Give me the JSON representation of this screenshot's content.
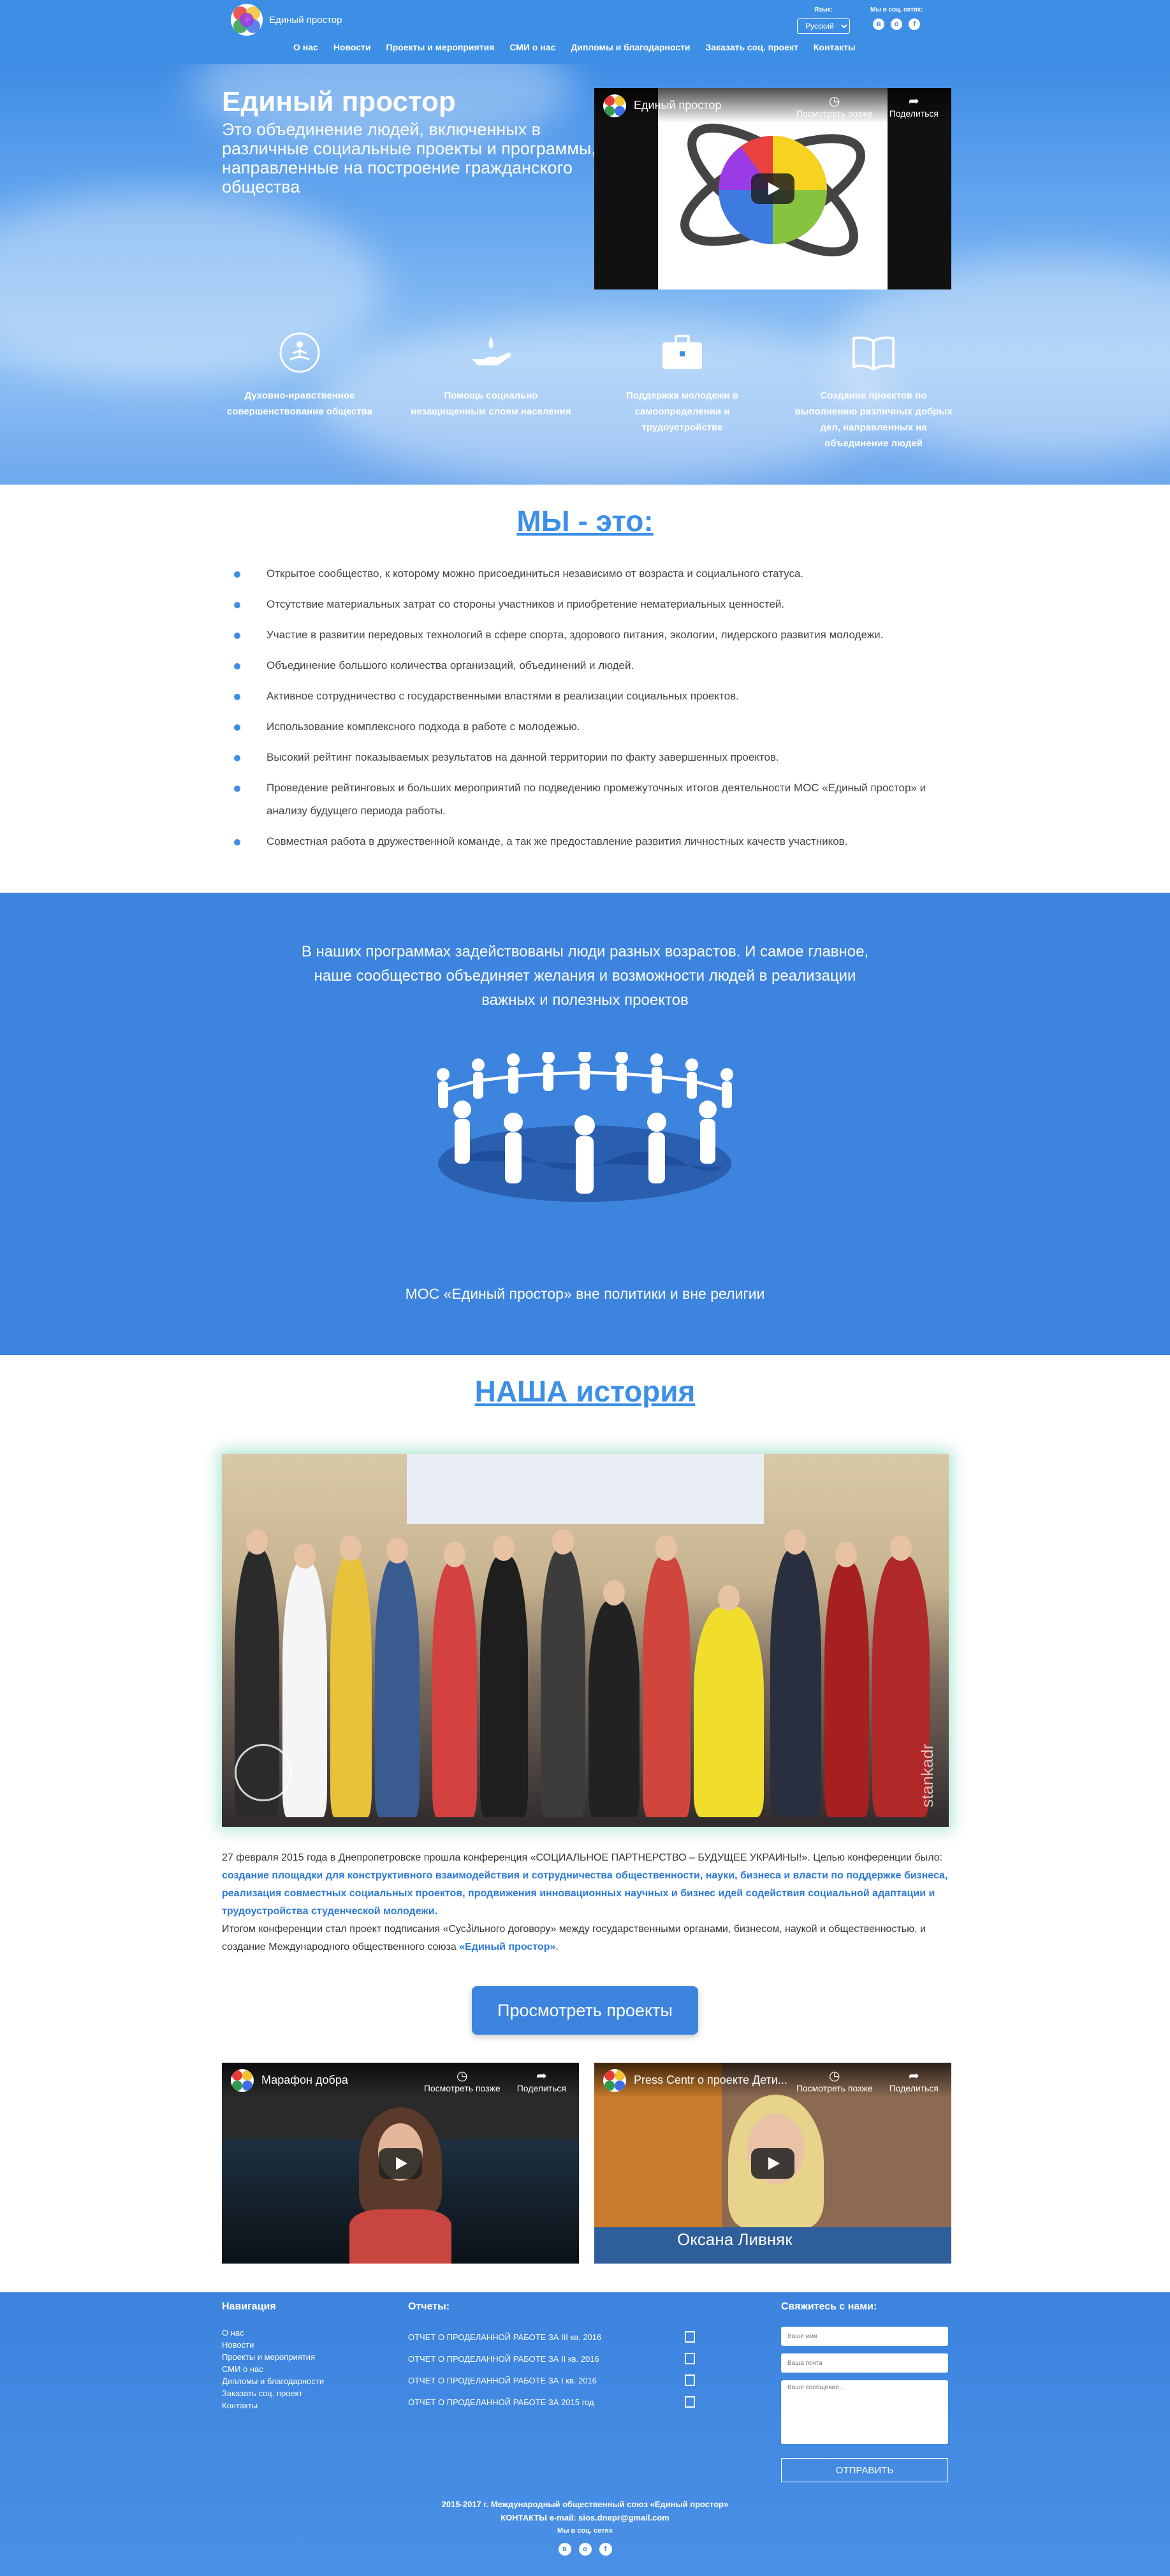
{
  "header": {
    "logo_text": "Единый простор",
    "lang_label": "Язык:",
    "lang_value": "Русский",
    "social_label": "Мы в соц. сетях:",
    "social_icons": [
      "vk-icon",
      "odnoklassniki-icon",
      "facebook-icon"
    ],
    "nav": [
      "О нас",
      "Новости",
      "Проекты и мероприятия",
      "СМИ о нас",
      "Дипломы и благодарности",
      "Заказать соц. проект",
      "Контакты"
    ]
  },
  "hero": {
    "title": "Единый простор",
    "subtitle": "Это объединение людей, включенных в различные социальные проекты и программы, направленные на построение гражданского общества",
    "video": {
      "title": "Единый простор",
      "watch_later": "Посмотреть позже",
      "share": "Поделиться"
    },
    "features": [
      {
        "icon": "meditation-icon",
        "text": "Духовно-нравственное совершенствование общества"
      },
      {
        "icon": "hand-drop-icon",
        "text": "Помощь социально незащищенным слоям населения"
      },
      {
        "icon": "briefcase-icon",
        "text": "Поддержка молодежи в самоопределении и трудоустройстве"
      },
      {
        "icon": "book-icon",
        "text": "Создание проектов по выполнению различных добрых дел, направленных на объединение людей"
      }
    ]
  },
  "we": {
    "title": "МЫ - это:",
    "items": [
      "Открытое сообщество, к которому можно присоединиться независимо от возраста и социального статуса.",
      "Отсутствие материальных затрат со стороны участников и приобретение нематериальных ценностей.",
      "Участие в развитии передовых технологий в сфере спорта, здорового питания, экологии, лидерского развития молодежи.",
      "Объединение большого количества организаций, объединений и людей.",
      "Активное сотрудничество с государственными властями в реализации социальных проектов.",
      "Использование комплексного подхода в работе с молодежью.",
      "Высокий рейтинг показываемых результатов на данной территории по факту завершенных проектов.",
      "Проведение рейтинговых и больших мероприятий по подведению промежуточных итогов деятельности МОС «Единый простор» и анализу будущего периода работы.",
      "Совместная работа в дружественной команде, а так же предоставление развития личностных качеств участников."
    ]
  },
  "people": {
    "text": "В наших программах задействованы люди разных возрастов. И самое главное, наше сообщество объединяет желания и возможности людей в реализации важных и полезных проектов",
    "footer": "МОС «Единый простор» вне политики и вне религии"
  },
  "history": {
    "title": "НАША история",
    "photo_watermark": "stankadr",
    "p1_a": "27 февраля 2015 года в Днепропетровске прошла конференция «СОЦИАЛЬНОЕ ПАРТНЕРСТВО – БУДУЩЕЕ УКРАИНЫ!». Целью конференции было: ",
    "p1_b": "создание площадки для конструктивного взаимодействия и сотрудничества общественности, науки, бизнеса и власти по поддержке бизнеса, реализация совместных социальных проектов, продвижения инновационных научных и бизнес идей содействия социальной адаптации и трудоустройства студенческой молодежи.",
    "p2_a": "Итогом конференции стал проект подписания «Сусპільного договору» между государственными органами, бизнесом, наукой и общественностью, и создание Международного общественного союза ",
    "p2_b": "«Единый простор»",
    "p2_c": ".",
    "button": "Просмотреть проекты",
    "videos": [
      {
        "title": "Марафон добра",
        "watch_later": "Посмотреть позже",
        "share": "Поделиться"
      },
      {
        "title": "Press Centr о проекте Дети...",
        "watch_later": "Посмотреть позже",
        "share": "Поделиться",
        "caption_name": "Оксана Ливняк"
      }
    ]
  },
  "footer": {
    "nav_title": "Навигация",
    "nav": [
      "О нас",
      "Новости",
      "Проекты и мероприятия",
      "СМИ о нас",
      "Дипломы и благодарности",
      "Заказать соц. проект",
      "Контакты"
    ],
    "reports_title": "Отчеты:",
    "reports": [
      "ОТЧЕТ О ПРОДЕЛАННОЙ РАБОТЕ ЗА III кв. 2016",
      "ОТЧЕТ О ПРОДЕЛАННОЙ РАБОТЕ ЗА II кв. 2016",
      "ОТЧЕТ О ПРОДЕЛАННОЙ РАБОТЕ ЗА I кв. 2016",
      "ОТЧЕТ О ПРОДЕЛАННОЙ РАБОТЕ ЗА 2015 год"
    ],
    "contact_title": "Свяжитесь с нами:",
    "name_placeholder": "Ваше имя",
    "email_placeholder": "Ваша почта",
    "message_placeholder": "Ваше сообщение...",
    "send": "ОТПРАВИТЬ",
    "copyright": "2015-2017 г. Международный общественный союз «Единый простор»",
    "contacts": "КОНТАКТЫ e-mail: sios.dnepr@gmail.com",
    "social_label": "Мы в соц. сетях"
  },
  "colors": {
    "brand": "#3d8fe6",
    "accent_dark": "#2e7ad6",
    "section_blue": "#3d84df"
  }
}
